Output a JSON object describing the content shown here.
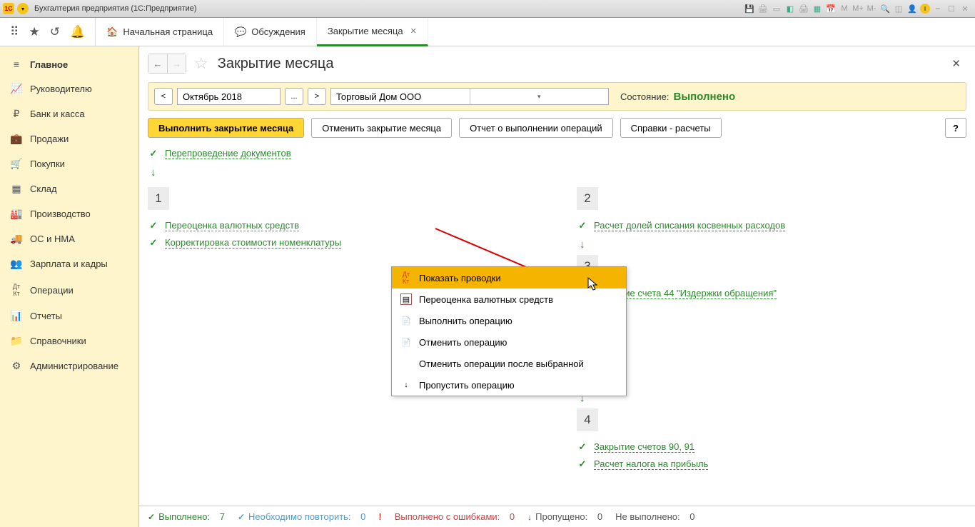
{
  "titlebar": {
    "app_badge": "1C",
    "title": "Бухгалтерия предприятия  (1С:Предприятие)",
    "m_plain": "M",
    "m_plus": "M+",
    "m_minus": "M-",
    "info": "i"
  },
  "tabs": {
    "home": "Начальная страница",
    "discussions": "Обсуждения",
    "closing": "Закрытие месяца"
  },
  "sidebar": {
    "items": [
      {
        "label": "Главное"
      },
      {
        "label": "Руководителю"
      },
      {
        "label": "Банк и касса"
      },
      {
        "label": "Продажи"
      },
      {
        "label": "Покупки"
      },
      {
        "label": "Склад"
      },
      {
        "label": "Производство"
      },
      {
        "label": "ОС и НМА"
      },
      {
        "label": "Зарплата и кадры"
      },
      {
        "label": "Операции"
      },
      {
        "label": "Отчеты"
      },
      {
        "label": "Справочники"
      },
      {
        "label": "Администрирование"
      }
    ]
  },
  "page": {
    "title": "Закрытие месяца",
    "period": "Октябрь 2018",
    "org": "Торговый Дом ООО",
    "state_label": "Состояние:",
    "state_value": "Выполнено",
    "btn_execute": "Выполнить закрытие месяца",
    "btn_cancel": "Отменить закрытие месяца",
    "btn_report": "Отчет о выполнении операций",
    "btn_references": "Справки - расчеты",
    "help": "?"
  },
  "ops": {
    "reposting": "Перепроведение документов",
    "stage1": "1",
    "op1a": "Переоценка валютных средств",
    "op1b": "Корректировка стоимости номенклатуры",
    "stage2": "2",
    "op2a": "Расчет долей списания косвенных расходов",
    "stage3": "3",
    "op3a": "Закрытие счета 44 \"Издержки обращения\"",
    "stage4": "4",
    "op4a": "Закрытие счетов 90, 91",
    "op4b": "Расчет налога на прибыль"
  },
  "menu": {
    "show_entries": "Показать проводки",
    "revaluation": "Переоценка валютных средств",
    "execute_op": "Выполнить операцию",
    "cancel_op": "Отменить операцию",
    "cancel_after": "Отменить операции после выбранной",
    "skip_op": "Пропустить операцию"
  },
  "status": {
    "done_label": "Выполнено:",
    "done_count": "7",
    "repeat_label": "Необходимо повторить:",
    "repeat_count": "0",
    "errors_label": "Выполнено с ошибками:",
    "errors_count": "0",
    "skipped_label": "Пропущено:",
    "skipped_count": "0",
    "not_done_label": "Не выполнено:",
    "not_done_count": "0"
  }
}
